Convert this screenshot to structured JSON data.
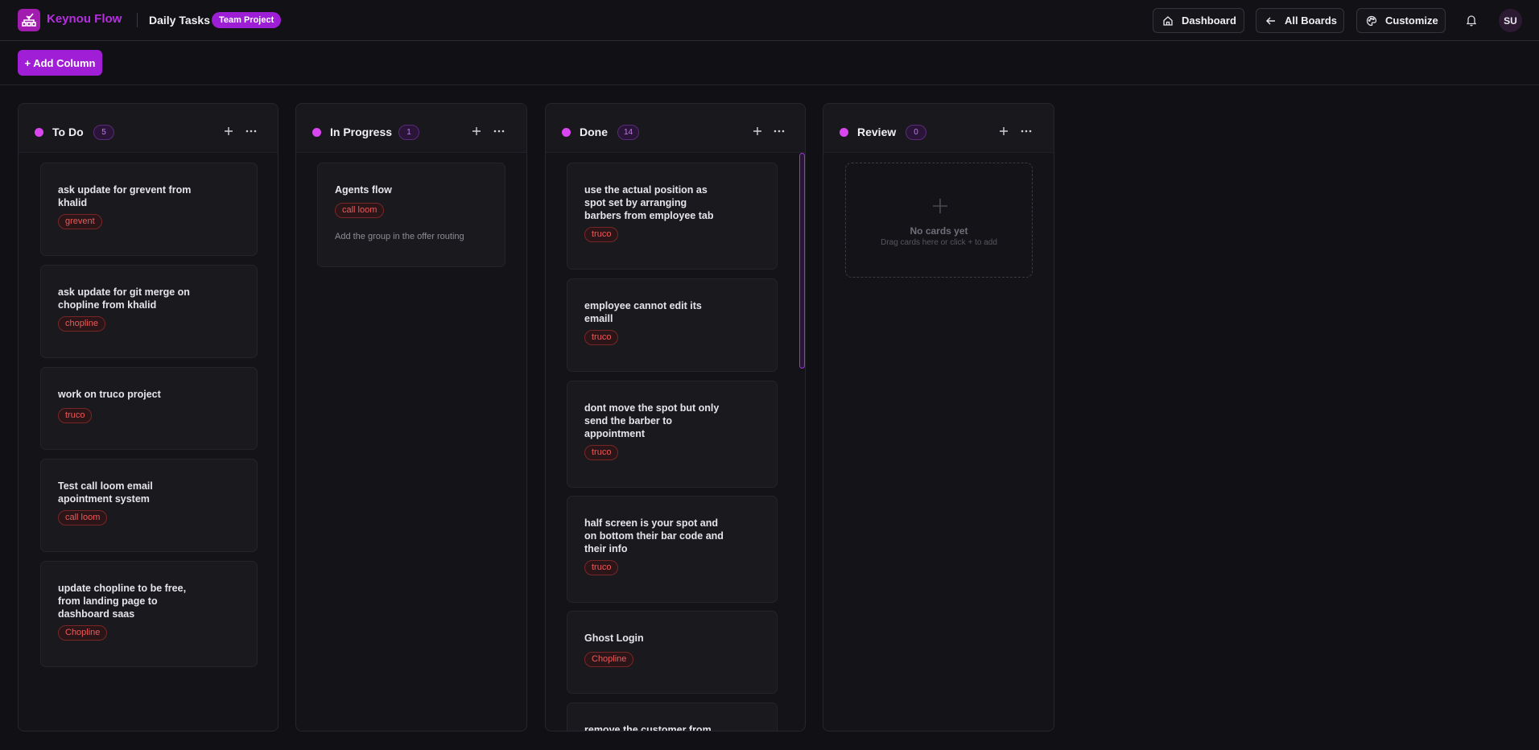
{
  "header": {
    "app_name": "Keynou Flow",
    "board_title": "Daily Tasks",
    "badge": "Team Project",
    "buttons": {
      "dashboard": "Dashboard",
      "all_boards": "All Boards",
      "customize": "Customize"
    },
    "avatar_initials": "SU",
    "icons": [
      "home-icon",
      "arrow-left-icon",
      "palette-icon",
      "bell-icon"
    ]
  },
  "toolbar": {
    "add_column": "+ Add Column"
  },
  "colors": {
    "accent": "#a01fd6",
    "brand_text": "#b62ee0",
    "column_dot": "#d946ef",
    "tag_text": "#ec5a5a",
    "background": "#111115"
  },
  "columns": [
    {
      "title": "To Do",
      "count": "5",
      "cards": [
        {
          "title": "ask update for grevent from khalid",
          "tag": "grevent"
        },
        {
          "title": "ask update for git merge on chopline from khalid",
          "tag": "chopline"
        },
        {
          "title": "work on truco project",
          "tag": "truco"
        },
        {
          "title": "Test call loom email apointment system",
          "tag": "call loom"
        },
        {
          "title": "update chopline to be free, from landing page to dashboard saas",
          "tag": "Chopline"
        }
      ]
    },
    {
      "title": "In Progress",
      "count": "1",
      "cards": [
        {
          "title": "Agents flow",
          "tag": "call loom",
          "description": "Add the group in the offer routing"
        }
      ]
    },
    {
      "title": "Done",
      "count": "14",
      "cards": [
        {
          "title": "use the actual position as spot set by arranging barbers from employee tab",
          "tag": "truco"
        },
        {
          "title": "employee cannot edit its emaill",
          "tag": "truco"
        },
        {
          "title": "dont move the spot but only send the barber to appointment",
          "tag": "truco"
        },
        {
          "title": "half screen is your spot and on bottom their bar code and their info",
          "tag": "truco"
        },
        {
          "title": "Ghost Login",
          "tag": "Chopline"
        },
        {
          "title": "remove the customer from"
        }
      ]
    },
    {
      "title": "Review",
      "count": "0",
      "empty": {
        "title": "No cards yet",
        "subtitle": "Drag cards here or click + to add"
      }
    }
  ]
}
